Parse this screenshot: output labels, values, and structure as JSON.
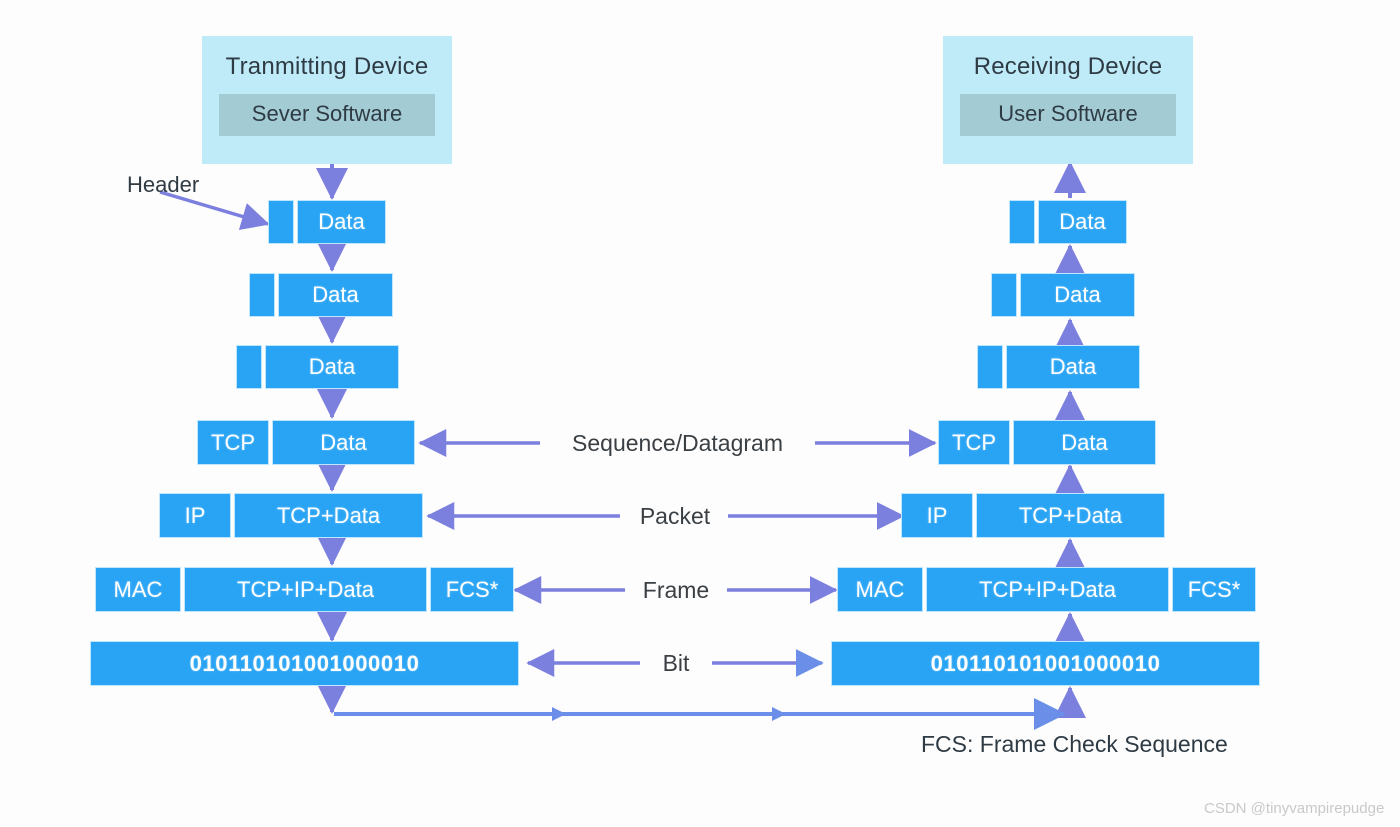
{
  "colors": {
    "block_blue": "#29a4f5",
    "block_border": "#bfe6ff",
    "device_box": "#bfeaf7",
    "device_inner": "#a3cbd4",
    "arrow_purple": "#7b7fde",
    "arrow_blue": "#6b8fe8",
    "text_dark": "#2f3b44",
    "background": "#fdfdfd",
    "watermark": "#c9c9c9"
  },
  "transmitting": {
    "title": "Tranmitting Device",
    "software": "Sever Software"
  },
  "receiving": {
    "title": "Receiving Device",
    "software": "User Software"
  },
  "annotations": {
    "header_label": "Header",
    "footnote": "FCS: Frame Check Sequence",
    "watermark": "CSDN @tinyvampirepudge"
  },
  "middle_labels": [
    {
      "text": "Sequence/Datagram"
    },
    {
      "text": "Packet"
    },
    {
      "text": "Frame"
    },
    {
      "text": "Bit"
    }
  ],
  "left_stack": [
    {
      "name": "app-data-1",
      "segments": [
        {
          "text": ""
        },
        {
          "text": "Data"
        }
      ]
    },
    {
      "name": "app-data-2",
      "segments": [
        {
          "text": ""
        },
        {
          "text": "Data"
        }
      ]
    },
    {
      "name": "app-data-3",
      "segments": [
        {
          "text": ""
        },
        {
          "text": "Data"
        }
      ]
    },
    {
      "name": "transport",
      "segments": [
        {
          "text": "TCP"
        },
        {
          "text": "Data"
        }
      ]
    },
    {
      "name": "network",
      "segments": [
        {
          "text": "IP"
        },
        {
          "text": "TCP+Data"
        }
      ]
    },
    {
      "name": "datalink",
      "segments": [
        {
          "text": "MAC"
        },
        {
          "text": "TCP+IP+Data"
        },
        {
          "text": "FCS*"
        }
      ]
    },
    {
      "name": "physical",
      "segments": [
        {
          "text": "010110101001000010"
        }
      ]
    }
  ],
  "right_stack": [
    {
      "name": "app-data-1",
      "segments": [
        {
          "text": ""
        },
        {
          "text": "Data"
        }
      ]
    },
    {
      "name": "app-data-2",
      "segments": [
        {
          "text": ""
        },
        {
          "text": "Data"
        }
      ]
    },
    {
      "name": "app-data-3",
      "segments": [
        {
          "text": ""
        },
        {
          "text": "Data"
        }
      ]
    },
    {
      "name": "transport",
      "segments": [
        {
          "text": "TCP"
        },
        {
          "text": "Data"
        }
      ]
    },
    {
      "name": "network",
      "segments": [
        {
          "text": "IP"
        },
        {
          "text": "TCP+Data"
        }
      ]
    },
    {
      "name": "datalink",
      "segments": [
        {
          "text": "MAC"
        },
        {
          "text": "TCP+IP+Data"
        },
        {
          "text": "FCS*"
        }
      ]
    },
    {
      "name": "physical",
      "segments": [
        {
          "text": "010110101001000010"
        }
      ]
    }
  ]
}
